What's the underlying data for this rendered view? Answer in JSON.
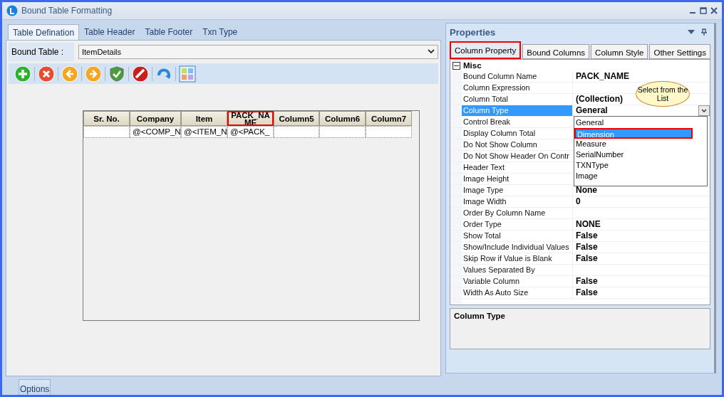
{
  "window": {
    "title": "Bound Table Formatting"
  },
  "tabs": [
    {
      "label": "Table Defination",
      "selected": true
    },
    {
      "label": "Table Header",
      "selected": false
    },
    {
      "label": "Table Footer",
      "selected": false
    },
    {
      "label": "Txn Type",
      "selected": false
    }
  ],
  "bound_table": {
    "label": "Bound Table :",
    "value": "ItemDetails"
  },
  "toolbar": [
    {
      "kind": "add"
    },
    {
      "kind": "delete"
    },
    {
      "kind": "back"
    },
    {
      "kind": "forward"
    },
    {
      "kind": "verify"
    },
    {
      "kind": "stop"
    },
    {
      "kind": "refresh"
    },
    {
      "kind": "layout"
    }
  ],
  "table": {
    "columns": [
      {
        "label": "Sr. No.",
        "selected": false
      },
      {
        "label": "Company",
        "selected": false
      },
      {
        "label": "Item",
        "selected": false
      },
      {
        "label": "PACK_NAME",
        "selected": true
      },
      {
        "label": "Column5",
        "selected": false
      },
      {
        "label": "Column6",
        "selected": false
      },
      {
        "label": "Column7",
        "selected": false
      }
    ],
    "rows": [
      [
        "",
        "@<COMP_N",
        "@<ITEM_N",
        "@<PACK_",
        "",
        "",
        ""
      ]
    ]
  },
  "properties": {
    "title": "Properties",
    "tabs": [
      {
        "label": "Column Property",
        "selected": true
      },
      {
        "label": "Bound Columns",
        "selected": false
      },
      {
        "label": "Column Style",
        "selected": false
      },
      {
        "label": "Other Settings",
        "selected": false
      }
    ],
    "category": {
      "name": "Misc",
      "expanded": true
    },
    "rows": [
      {
        "name": "Bound Column Name",
        "value": "PACK_NAME",
        "selected": false
      },
      {
        "name": "Column Expression",
        "selected": false
      },
      {
        "name": "Column Total",
        "value": "(Collection)",
        "selected": false
      },
      {
        "name": "Column Type",
        "value": "General",
        "selected": true
      },
      {
        "name": "Control Break",
        "selected": false
      },
      {
        "name": "Display Column Total",
        "selected": false
      },
      {
        "name": "Do Not Show Column",
        "selected": false
      },
      {
        "name": "Do Not Show Header On Contr",
        "selected": false
      },
      {
        "name": "Header Text",
        "selected": false
      },
      {
        "name": "Image Height",
        "selected": false
      },
      {
        "name": "Image Type",
        "value": "None",
        "selected": false
      },
      {
        "name": "Image Width",
        "value": "0",
        "selected": false
      },
      {
        "name": "Order By Column Name",
        "selected": false
      },
      {
        "name": "Order Type",
        "value": "NONE",
        "selected": false
      },
      {
        "name": "Show Total",
        "value": "False",
        "selected": false
      },
      {
        "name": "Show/Include Individual Values",
        "value": "False",
        "selected": false
      },
      {
        "name": "Skip Row if Value is Blank",
        "value": "False",
        "selected": false
      },
      {
        "name": "Values Separated By",
        "selected": false
      },
      {
        "name": "Variable Column",
        "value": "False",
        "selected": false
      },
      {
        "name": "Width As Auto Size",
        "value": "False",
        "selected": false
      }
    ],
    "dropdown": [
      {
        "label": "General",
        "selected": false
      },
      {
        "label": "Dimension",
        "selected": true
      },
      {
        "label": "Measure",
        "selected": false
      },
      {
        "label": "SerialNumber",
        "selected": false
      },
      {
        "label": "TXNType",
        "selected": false
      },
      {
        "label": "Image",
        "selected": false
      }
    ],
    "callout": "Select from the List",
    "description_title": "Column Type"
  },
  "bottom_tabs": [
    {
      "label": "Options"
    }
  ]
}
